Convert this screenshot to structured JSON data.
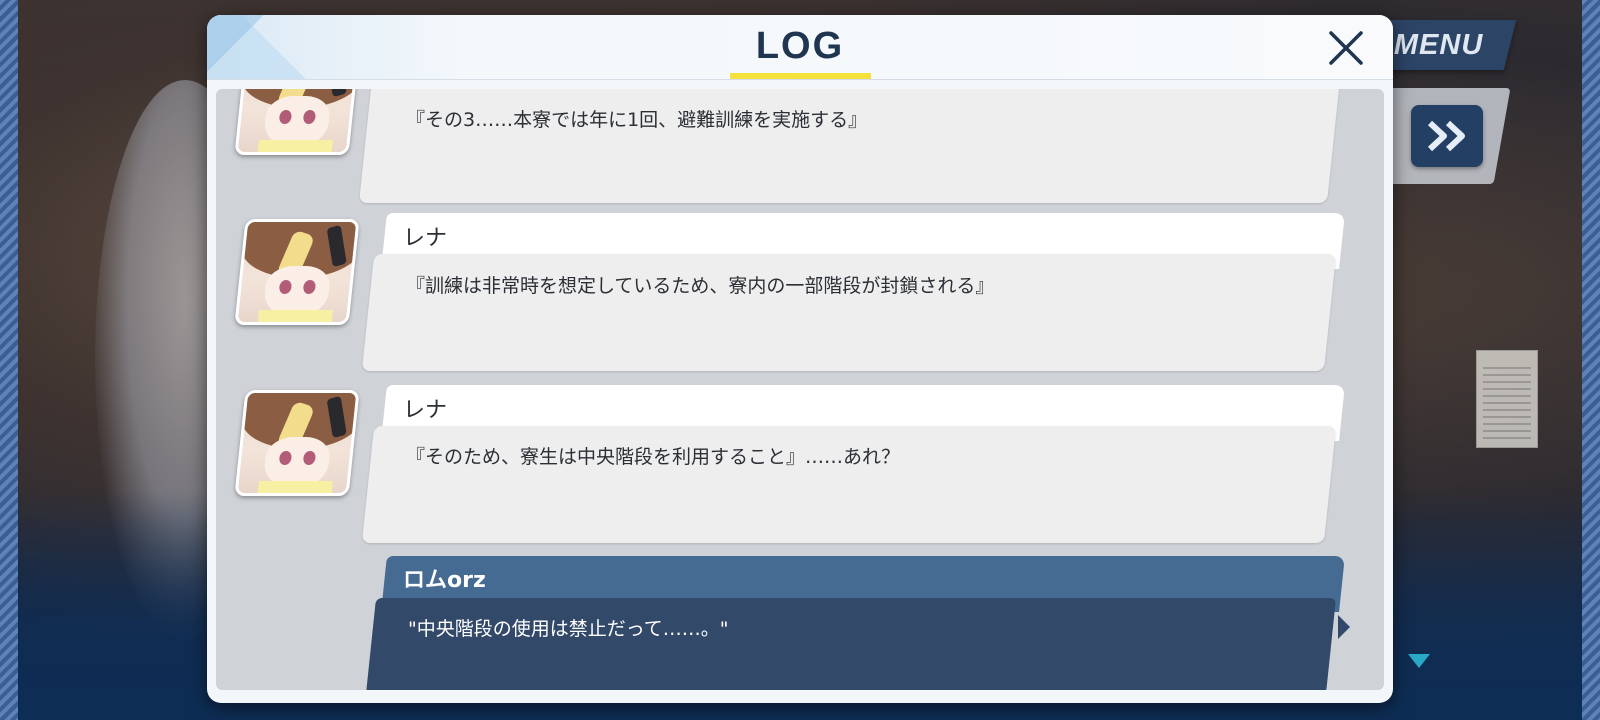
{
  "hud": {
    "menu_label": "MENU",
    "skip_icon": "fast-forward-icon",
    "scroll_icon": "triangle-down-icon"
  },
  "log": {
    "title": "LOG",
    "close_icon": "close-icon",
    "entries": [
      {
        "speaker": "",
        "text": "『その3……本寮では年に1回、避難訓練を実施する』"
      },
      {
        "speaker": "レナ",
        "text": "『訓練は非常時を想定しているため、寮内の一部階段が封鎖される』"
      },
      {
        "speaker": "レナ",
        "text": "『そのため、寮生は中央階段を利用すること』……あれ？"
      },
      {
        "speaker": "ロムorz",
        "text": "\"中央階段の使用は禁止だって……。\""
      }
    ]
  },
  "colors": {
    "title_accent": "#f4e13a",
    "player_name_bg": "#466b93",
    "player_bubble_bg": "#33496a",
    "npc_bubble_bg": "#eeeeee"
  }
}
